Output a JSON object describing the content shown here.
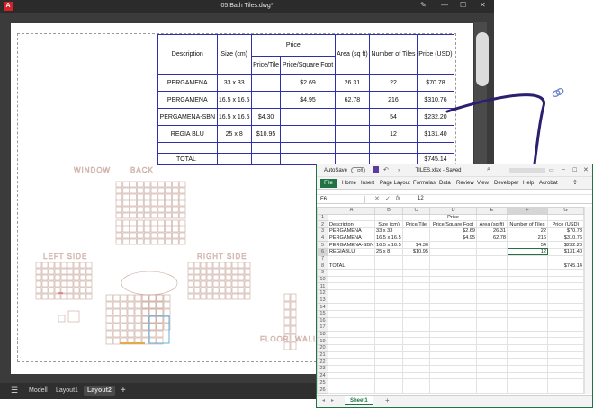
{
  "cad": {
    "logo": "A",
    "title": "05 Bath Tiles.dwg*",
    "layout_tabs": [
      "Modell",
      "Layout1",
      "Layout2"
    ],
    "active_tab": "Layout2",
    "add_tab": "+",
    "drawing_labels": [
      "WINDOW",
      "BACK",
      "LEFT SIDE",
      "RIGHT SIDE",
      "FLOOR",
      "WALL"
    ],
    "table": {
      "headers": {
        "description": "Description",
        "size": "Size (cm)",
        "price": "Price",
        "area": "Area (sq ft)",
        "tiles": "Number of Tiles",
        "price_usd": "Price (USD)",
        "price_tile": "Price/Tile",
        "price_sqft": "Price/Square Foot"
      },
      "rows": [
        {
          "desc": "PERGAMENA",
          "size": "33 x 33",
          "ptile": "",
          "psqft": "$2.69",
          "area": "26.31",
          "tiles": "22",
          "usd": "$70.78"
        },
        {
          "desc": "PERGAMENA",
          "size": "16.5 x 16.5",
          "ptile": "",
          "psqft": "$4.95",
          "area": "62.78",
          "tiles": "216",
          "usd": "$310.76"
        },
        {
          "desc": "PERGAMENA-SBN",
          "size": "16.5 x 16.5",
          "ptile": "$4.30",
          "psqft": "",
          "area": "",
          "tiles": "54",
          "usd": "$232.20"
        },
        {
          "desc": "REGIA BLU",
          "size": "25 x 8",
          "ptile": "$10.95",
          "psqft": "",
          "area": "",
          "tiles": "12",
          "usd": "$131.40"
        }
      ],
      "total_label": "TOTAL",
      "total_value": "$745.14"
    }
  },
  "excel": {
    "autosave": "AutoSave",
    "autosave_state": "Off",
    "title": "TILES.xlsx - Saved",
    "ribbon": [
      "File",
      "Home",
      "Insert",
      "Page Layout",
      "Formulas",
      "Data",
      "Review",
      "View",
      "Developer",
      "Help",
      "Acrobat"
    ],
    "name_box": "F6",
    "fx": "fx",
    "formula": "12",
    "columns": [
      "A",
      "B",
      "C",
      "D",
      "E",
      "F",
      "G"
    ],
    "row_numbers": [
      "1",
      "2",
      "3",
      "4",
      "5",
      "6",
      "7",
      "8",
      "9",
      "10",
      "11",
      "12",
      "13",
      "14",
      "15",
      "16",
      "17",
      "18",
      "19",
      "20",
      "21",
      "22",
      "23",
      "24",
      "25",
      "26"
    ],
    "header_row1": {
      "D": "Price"
    },
    "header_row2": {
      "A": "Descripton",
      "B": "Size (cm)",
      "C": "Price/Tile",
      "D": "Price/Square Foot",
      "E": "Area (sq ft)",
      "F": "Number of Tiles",
      "G": "Price (USD)"
    },
    "rows": [
      {
        "A": "PERGAMENA",
        "B": "33 x 33",
        "C": "",
        "D": "$2.69",
        "E": "26.31",
        "F": "22",
        "G": "$70.78"
      },
      {
        "A": "PERGAMENA",
        "B": "16.5 x 16.5",
        "C": "",
        "D": "$4.95",
        "E": "62.78",
        "F": "216",
        "G": "$310.76"
      },
      {
        "A": "PERGAMENA-SBN",
        "B": "16.5 x 16.5",
        "C": "$4.30",
        "D": "",
        "E": "",
        "F": "54",
        "G": "$232.20"
      },
      {
        "A": "REGIABLU",
        "B": "25 x 8",
        "C": "$10.95",
        "D": "",
        "E": "",
        "F": "12",
        "G": "$131.40"
      }
    ],
    "total_label": "TOTAL",
    "total_value": "$745.14",
    "sheet_tab": "Sheet1",
    "add_sheet": "+"
  },
  "colors": {
    "excel_green": "#217346",
    "cad_table_border": "#2f2fa8",
    "arrow": "#2c1f6e",
    "cad_dark": "#3b3b3b",
    "drawing_beige": "#c9a79c"
  }
}
